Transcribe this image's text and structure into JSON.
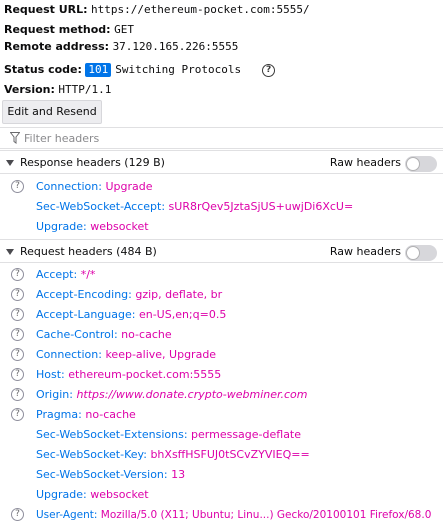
{
  "summary": {
    "url_key": "Request URL:",
    "url_val": "https://ethereum-pocket.com:5555/",
    "method_key": "Request method:",
    "method_val": "GET",
    "remote_key": "Remote address:",
    "remote_val": "37.120.165.226:5555",
    "status_key": "Status code:",
    "status_code": "101",
    "status_text": "Switching Protocols",
    "version_key": "Version:",
    "version_val": "HTTP/1.1"
  },
  "edit_resend_label": "Edit and Resend",
  "filter": {
    "placeholder": "Filter headers"
  },
  "response_section": {
    "title": "Response headers (129 B)",
    "raw_label": "Raw headers"
  },
  "response_headers": [
    {
      "name": "Connection:",
      "value": "Upgrade"
    },
    {
      "name": "Sec-WebSocket-Accept:",
      "value": "sUR8rQev5JztaSjUS+uwjDi6XcU="
    },
    {
      "name": "Upgrade:",
      "value": "websocket"
    }
  ],
  "request_section": {
    "title": "Request headers (484 B)",
    "raw_label": "Raw headers"
  },
  "request_headers": [
    {
      "name": "Accept:",
      "value": "*/*"
    },
    {
      "name": "Accept-Encoding:",
      "value": "gzip, deflate, br"
    },
    {
      "name": "Accept-Language:",
      "value": "en-US,en;q=0.5"
    },
    {
      "name": "Cache-Control:",
      "value": "no-cache"
    },
    {
      "name": "Connection:",
      "value": "keep-alive, Upgrade"
    },
    {
      "name": "Host:",
      "value": "ethereum-pocket.com:5555"
    },
    {
      "name": "Origin:",
      "value": "https://www.donate.crypto-webminer.com"
    },
    {
      "name": "Pragma:",
      "value": "no-cache"
    },
    {
      "name": "Sec-WebSocket-Extensions:",
      "value": "permessage-deflate"
    },
    {
      "name": "Sec-WebSocket-Key:",
      "value": "bhXsffHSFUJ0tSCvZYVIEQ=="
    },
    {
      "name": "Sec-WebSocket-Version:",
      "value": "13"
    },
    {
      "name": "Upgrade:",
      "value": "websocket"
    },
    {
      "name": "User-Agent:",
      "value": "Mozilla/5.0 (X11; Ubuntu; Linu...) Gecko/20100101 Firefox/68.0"
    }
  ],
  "icons": {
    "help": "question-circle-icon",
    "filter": "funnel-icon",
    "twisty": "triangle-down-icon"
  },
  "colors": {
    "accent": "#0074e8",
    "value": "#dd00a9"
  }
}
